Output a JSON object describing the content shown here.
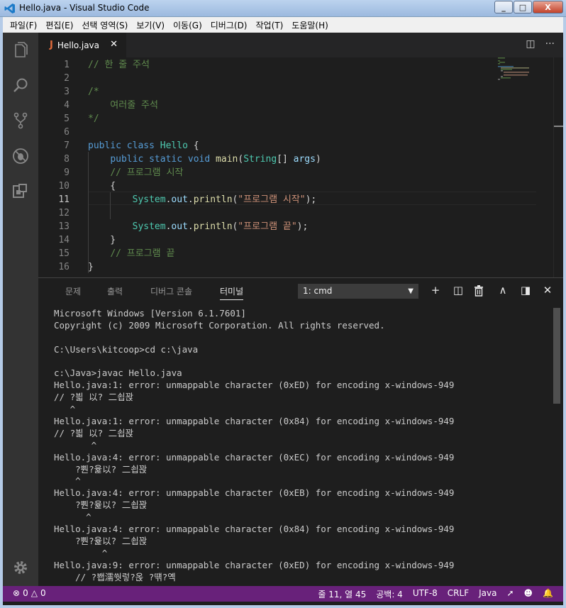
{
  "window": {
    "title": "Hello.java - Visual Studio Code",
    "minimize": "_",
    "maximize": "□",
    "close": "X"
  },
  "menu": [
    "파일(F)",
    "편집(E)",
    "선택 영역(S)",
    "보기(V)",
    "이동(G)",
    "디버그(D)",
    "작업(T)",
    "도움말(H)"
  ],
  "activity": [
    "explorer-icon",
    "search-icon",
    "source-control-icon",
    "debug-icon",
    "extensions-icon",
    "settings-gear-icon"
  ],
  "tab": {
    "name": "Hello.java",
    "icon": "J",
    "close": "✕"
  },
  "tab_actions": {
    "split": "◫",
    "more": "···"
  },
  "editor": {
    "active_line": 11,
    "lines": [
      {
        "n": "1",
        "tokens": [
          [
            "c-com",
            "// 한 줄 주석"
          ]
        ]
      },
      {
        "n": "2",
        "tokens": []
      },
      {
        "n": "3",
        "tokens": [
          [
            "c-com",
            "/*"
          ]
        ]
      },
      {
        "n": "4",
        "tokens": [
          [
            "c-com",
            "    여러줄 주석"
          ]
        ]
      },
      {
        "n": "5",
        "tokens": [
          [
            "c-com",
            "*/"
          ]
        ]
      },
      {
        "n": "6",
        "tokens": []
      },
      {
        "n": "7",
        "tokens": [
          [
            "c-kw",
            "public"
          ],
          [
            "c-txt",
            " "
          ],
          [
            "c-kw",
            "class"
          ],
          [
            "c-txt",
            " "
          ],
          [
            "c-type",
            "Hello"
          ],
          [
            "c-txt",
            " {"
          ]
        ]
      },
      {
        "n": "8",
        "tokens": [
          [
            "c-txt",
            "    "
          ],
          [
            "c-kw",
            "public"
          ],
          [
            "c-txt",
            " "
          ],
          [
            "c-kw",
            "static"
          ],
          [
            "c-txt",
            " "
          ],
          [
            "c-kw",
            "void"
          ],
          [
            "c-txt",
            " "
          ],
          [
            "c-fn",
            "main"
          ],
          [
            "c-txt",
            "("
          ],
          [
            "c-type",
            "String"
          ],
          [
            "c-txt",
            "[] "
          ],
          [
            "c-var",
            "args"
          ],
          [
            "c-txt",
            ")"
          ]
        ]
      },
      {
        "n": "9",
        "tokens": [
          [
            "c-txt",
            "    "
          ],
          [
            "c-com",
            "// 프로그램 시작"
          ]
        ]
      },
      {
        "n": "10",
        "tokens": [
          [
            "c-txt",
            "    {"
          ]
        ]
      },
      {
        "n": "11",
        "tokens": [
          [
            "c-txt",
            "        "
          ],
          [
            "c-type",
            "System"
          ],
          [
            "c-txt",
            "."
          ],
          [
            "c-var",
            "out"
          ],
          [
            "c-txt",
            "."
          ],
          [
            "c-fn",
            "println"
          ],
          [
            "c-txt",
            "("
          ],
          [
            "c-str",
            "\"프로그램 시작\""
          ],
          [
            "c-txt",
            ");"
          ]
        ]
      },
      {
        "n": "12",
        "tokens": []
      },
      {
        "n": "13",
        "tokens": [
          [
            "c-txt",
            "        "
          ],
          [
            "c-type",
            "System"
          ],
          [
            "c-txt",
            "."
          ],
          [
            "c-var",
            "out"
          ],
          [
            "c-txt",
            "."
          ],
          [
            "c-fn",
            "println"
          ],
          [
            "c-txt",
            "("
          ],
          [
            "c-str",
            "\"프로그램 끝\""
          ],
          [
            "c-txt",
            ");"
          ]
        ]
      },
      {
        "n": "14",
        "tokens": [
          [
            "c-txt",
            "    }"
          ]
        ]
      },
      {
        "n": "15",
        "tokens": [
          [
            "c-txt",
            "    "
          ],
          [
            "c-com",
            "// 프로그램 끝"
          ]
        ]
      },
      {
        "n": "16",
        "tokens": [
          [
            "c-txt",
            "}"
          ]
        ]
      }
    ]
  },
  "panel": {
    "tabs": [
      "문제",
      "출력",
      "디버그 콘솔",
      "터미널"
    ],
    "active_tab": "터미널",
    "terminal_select": "1: cmd",
    "actions": {
      "add": "+",
      "split": "◫",
      "kill": "🗑",
      "maximize": "∧",
      "layout": "◨",
      "close": "✕"
    }
  },
  "terminal_lines": [
    "Microsoft Windows [Version 6.1.7601]",
    "Copyright (c) 2009 Microsoft Corporation. All rights reserved.",
    "",
    "C:\\Users\\kitcoop>cd c:\\java",
    "",
    "c:\\Java>javac Hello.java",
    "Hello.java:1: error: unmappable character (0xED) for encoding x-windows-949",
    "// ?븳 以? 二쇱꽍",
    "   ^",
    "Hello.java:1: error: unmappable character (0x84) for encoding x-windows-949",
    "// ?븳 以? 二쇱꽍",
    "       ^",
    "Hello.java:4: error: unmappable character (0xEC) for encoding x-windows-949",
    "    ?뿬?윭以? 二쇱꽍",
    "    ^",
    "Hello.java:4: error: unmappable character (0xEB) for encoding x-windows-949",
    "    ?뿬?윭以? 二쇱꽍",
    "      ^",
    "Hello.java:4: error: unmappable character (0x84) for encoding x-windows-949",
    "    ?뿬?윭以? 二쇱꽍",
    "         ^",
    "Hello.java:9: error: unmappable character (0xED) for encoding x-windows-949",
    "    // ?봽濡쒓렇?옩 ?떆?옉"
  ],
  "status": {
    "errors": "0",
    "warnings": "0",
    "position": "줄 11, 열 45",
    "spaces": "공백: 4",
    "encoding": "UTF-8",
    "eol": "CRLF",
    "language": "Java",
    "icons": [
      "error-icon",
      "warning-icon",
      "feedback-icon",
      "smiley-icon",
      "bell-icon"
    ]
  }
}
